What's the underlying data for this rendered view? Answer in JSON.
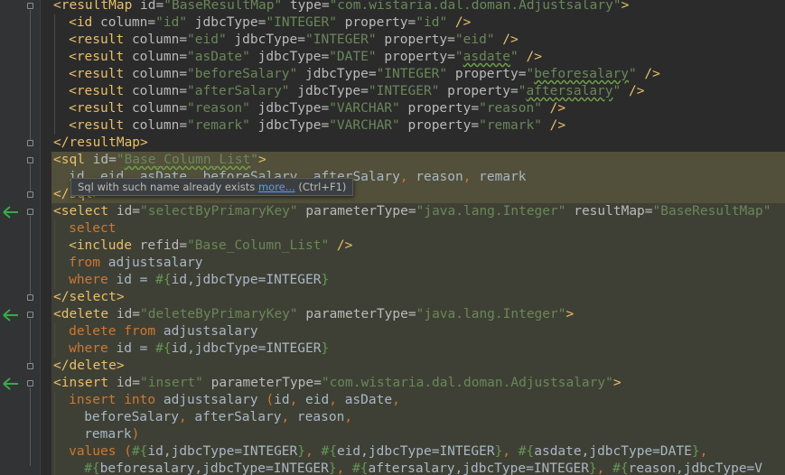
{
  "colors": {
    "background": "#2b2b2b",
    "gutter": "#313335",
    "tag": "#e8bf6a",
    "attribute": "#bababa",
    "value": "#6a8759",
    "sql_keyword": "#cc7832",
    "text": "#a9b7c6",
    "highlight": "#3f4035",
    "implementation_arrow": "#3aa84a"
  },
  "tooltip": {
    "message": "Sql with such name already exists",
    "link": "more...",
    "shortcut": "(Ctrl+F1)"
  },
  "icons": {
    "fold_marker": "fold-icon",
    "implementation_marker": "arrow-left-icon"
  },
  "lines": [
    {
      "tokens": [
        [
          "tag",
          "<resultMap "
        ],
        [
          "attr",
          "id="
        ],
        [
          "val",
          "\"BaseResultMap\""
        ],
        [
          "attr",
          " type="
        ],
        [
          "val",
          "\"com.wistaria.dal.doman.Adjustsalary\""
        ],
        [
          "tag",
          ">"
        ]
      ]
    },
    {
      "tokens": [
        [
          "tag",
          "<id "
        ],
        [
          "attr",
          "column="
        ],
        [
          "val",
          "\"id\""
        ],
        [
          "attr",
          " jdbcType="
        ],
        [
          "val",
          "\"INTEGER\""
        ],
        [
          "attr",
          " property="
        ],
        [
          "val",
          "\"id\""
        ],
        [
          "tag",
          " />"
        ]
      ]
    },
    {
      "tokens": [
        [
          "tag",
          "<result "
        ],
        [
          "attr",
          "column="
        ],
        [
          "val",
          "\"eid\""
        ],
        [
          "attr",
          " jdbcType="
        ],
        [
          "val",
          "\"INTEGER\""
        ],
        [
          "attr",
          " property="
        ],
        [
          "val",
          "\"eid\""
        ],
        [
          "tag",
          " />"
        ]
      ]
    },
    {
      "tokens": [
        [
          "tag",
          "<result "
        ],
        [
          "attr",
          "column="
        ],
        [
          "val",
          "\"asDate\""
        ],
        [
          "attr",
          " jdbcType="
        ],
        [
          "val",
          "\"DATE\""
        ],
        [
          "attr",
          " property="
        ],
        [
          "val",
          "\""
        ],
        [
          "valul",
          "asdate"
        ],
        [
          "val",
          "\""
        ],
        [
          "tag",
          " />"
        ]
      ]
    },
    {
      "tokens": [
        [
          "tag",
          "<result "
        ],
        [
          "attr",
          "column="
        ],
        [
          "val",
          "\"beforeSalary\""
        ],
        [
          "attr",
          " jdbcType="
        ],
        [
          "val",
          "\"INTEGER\""
        ],
        [
          "attr",
          " property="
        ],
        [
          "val",
          "\""
        ],
        [
          "valul",
          "beforesalary"
        ],
        [
          "val",
          "\""
        ],
        [
          "tag",
          " />"
        ]
      ]
    },
    {
      "tokens": [
        [
          "tag",
          "<result "
        ],
        [
          "attr",
          "column="
        ],
        [
          "val",
          "\"afterSalary\""
        ],
        [
          "attr",
          " jdbcType="
        ],
        [
          "val",
          "\"INTEGER\""
        ],
        [
          "attr",
          " property="
        ],
        [
          "val",
          "\""
        ],
        [
          "valul",
          "aftersalary"
        ],
        [
          "val",
          "\""
        ],
        [
          "tag",
          " />"
        ]
      ]
    },
    {
      "tokens": [
        [
          "tag",
          "<result "
        ],
        [
          "attr",
          "column="
        ],
        [
          "val",
          "\"reason\""
        ],
        [
          "attr",
          " jdbcType="
        ],
        [
          "val",
          "\"VARCHAR\""
        ],
        [
          "attr",
          " property="
        ],
        [
          "val",
          "\"reason\""
        ],
        [
          "tag",
          " />"
        ]
      ]
    },
    {
      "tokens": [
        [
          "tag",
          "<result "
        ],
        [
          "attr",
          "column="
        ],
        [
          "val",
          "\"remark\""
        ],
        [
          "attr",
          " jdbcType="
        ],
        [
          "val",
          "\"VARCHAR\""
        ],
        [
          "attr",
          " property="
        ],
        [
          "val",
          "\"remark\""
        ],
        [
          "tag",
          " />"
        ]
      ]
    },
    {
      "tokens": [
        [
          "tag",
          "</resultMap>"
        ]
      ]
    },
    {
      "tokens": [
        [
          "tag",
          "<sql "
        ],
        [
          "attr",
          "id="
        ],
        [
          "val",
          "\""
        ],
        [
          "valul",
          "Base_Column_List"
        ],
        [
          "val",
          "\""
        ],
        [
          "tag",
          ">"
        ]
      ]
    },
    {
      "tokens": [
        [
          "text",
          "id"
        ],
        [
          "punct",
          ", "
        ],
        [
          "text",
          "eid"
        ],
        [
          "punct",
          ", "
        ],
        [
          "text",
          "asDate"
        ],
        [
          "punct",
          ", "
        ],
        [
          "text",
          "beforeSalary"
        ],
        [
          "punct",
          ", "
        ],
        [
          "text",
          "afterSalary"
        ],
        [
          "punct",
          ", "
        ],
        [
          "text",
          "reason"
        ],
        [
          "punct",
          ", "
        ],
        [
          "text",
          "remark"
        ]
      ]
    },
    {
      "tokens": [
        [
          "tag",
          "</sql>"
        ]
      ]
    },
    {
      "tokens": [
        [
          "tag",
          "<select "
        ],
        [
          "attr",
          "id="
        ],
        [
          "val",
          "\"selectByPrimaryKey\""
        ],
        [
          "attr",
          " parameterType="
        ],
        [
          "val",
          "\"java.lang.Integer\""
        ],
        [
          "attr",
          " resultMap="
        ],
        [
          "val",
          "\"BaseResultMap\""
        ]
      ]
    },
    {
      "tokens": [
        [
          "sql",
          "select"
        ]
      ]
    },
    {
      "tokens": [
        [
          "tag",
          "<include "
        ],
        [
          "attr",
          "refid="
        ],
        [
          "val",
          "\"Base_Column_List\""
        ],
        [
          "tag",
          " />"
        ]
      ]
    },
    {
      "tokens": [
        [
          "sql",
          "from "
        ],
        [
          "text",
          "adjustsalary"
        ]
      ]
    },
    {
      "tokens": [
        [
          "sql",
          "where "
        ],
        [
          "text",
          "id = "
        ],
        [
          "brace",
          "#{"
        ],
        [
          "text",
          "id,jdbcType=INTEGER"
        ],
        [
          "brace",
          "}"
        ]
      ]
    },
    {
      "tokens": [
        [
          "tag",
          "</select>"
        ]
      ]
    },
    {
      "tokens": [
        [
          "tag",
          "<delete "
        ],
        [
          "attr",
          "id="
        ],
        [
          "val",
          "\"deleteByPrimaryKey\""
        ],
        [
          "attr",
          " parameterType="
        ],
        [
          "val",
          "\"java.lang.Integer\""
        ],
        [
          "tag",
          ">"
        ]
      ]
    },
    {
      "tokens": [
        [
          "sql",
          "delete from "
        ],
        [
          "text",
          "adjustsalary"
        ]
      ]
    },
    {
      "tokens": [
        [
          "sql",
          "where "
        ],
        [
          "text",
          "id = "
        ],
        [
          "brace",
          "#{"
        ],
        [
          "text",
          "id,jdbcType=INTEGER"
        ],
        [
          "brace",
          "}"
        ]
      ]
    },
    {
      "tokens": [
        [
          "tag",
          "</delete>"
        ]
      ]
    },
    {
      "tokens": [
        [
          "tag",
          "<insert "
        ],
        [
          "attr",
          "id="
        ],
        [
          "val",
          "\"insert\""
        ],
        [
          "attr",
          " parameterType="
        ],
        [
          "val",
          "\"com.wistaria.dal.doman.Adjustsalary\""
        ],
        [
          "tag",
          ">"
        ]
      ]
    },
    {
      "tokens": [
        [
          "sql",
          "insert into "
        ],
        [
          "text",
          "adjustsalary "
        ],
        [
          "punct",
          "("
        ],
        [
          "text",
          "id"
        ],
        [
          "punct",
          ", "
        ],
        [
          "text",
          "eid"
        ],
        [
          "punct",
          ", "
        ],
        [
          "text",
          "asDate"
        ],
        [
          "punct",
          ","
        ]
      ]
    },
    {
      "tokens": [
        [
          "text",
          "beforeSalary"
        ],
        [
          "punct",
          ", "
        ],
        [
          "text",
          "afterSalary"
        ],
        [
          "punct",
          ", "
        ],
        [
          "text",
          "reason"
        ],
        [
          "punct",
          ","
        ]
      ]
    },
    {
      "tokens": [
        [
          "text",
          "remark"
        ],
        [
          "punct",
          ")"
        ]
      ]
    },
    {
      "tokens": [
        [
          "sql",
          "values "
        ],
        [
          "punct",
          "("
        ],
        [
          "brace",
          "#{"
        ],
        [
          "text",
          "id,jdbcType=INTEGER"
        ],
        [
          "brace",
          "}"
        ],
        [
          "punct",
          ", "
        ],
        [
          "brace",
          "#{"
        ],
        [
          "text",
          "eid,jdbcType=INTEGER"
        ],
        [
          "brace",
          "}"
        ],
        [
          "punct",
          ", "
        ],
        [
          "brace",
          "#{"
        ],
        [
          "text",
          "asdate,jdbcType=DATE"
        ],
        [
          "brace",
          "}"
        ],
        [
          "punct",
          ","
        ]
      ]
    },
    {
      "tokens": [
        [
          "brace",
          "#{"
        ],
        [
          "text",
          "beforesalary,jdbcType=INTEGER"
        ],
        [
          "brace",
          "}"
        ],
        [
          "punct",
          ", "
        ],
        [
          "brace",
          "#{"
        ],
        [
          "text",
          "aftersalary,jdbcType=INTEGER"
        ],
        [
          "brace",
          "}"
        ],
        [
          "punct",
          ", "
        ],
        [
          "brace",
          "#{"
        ],
        [
          "text",
          "reason,jdbcType=V"
        ]
      ]
    }
  ]
}
